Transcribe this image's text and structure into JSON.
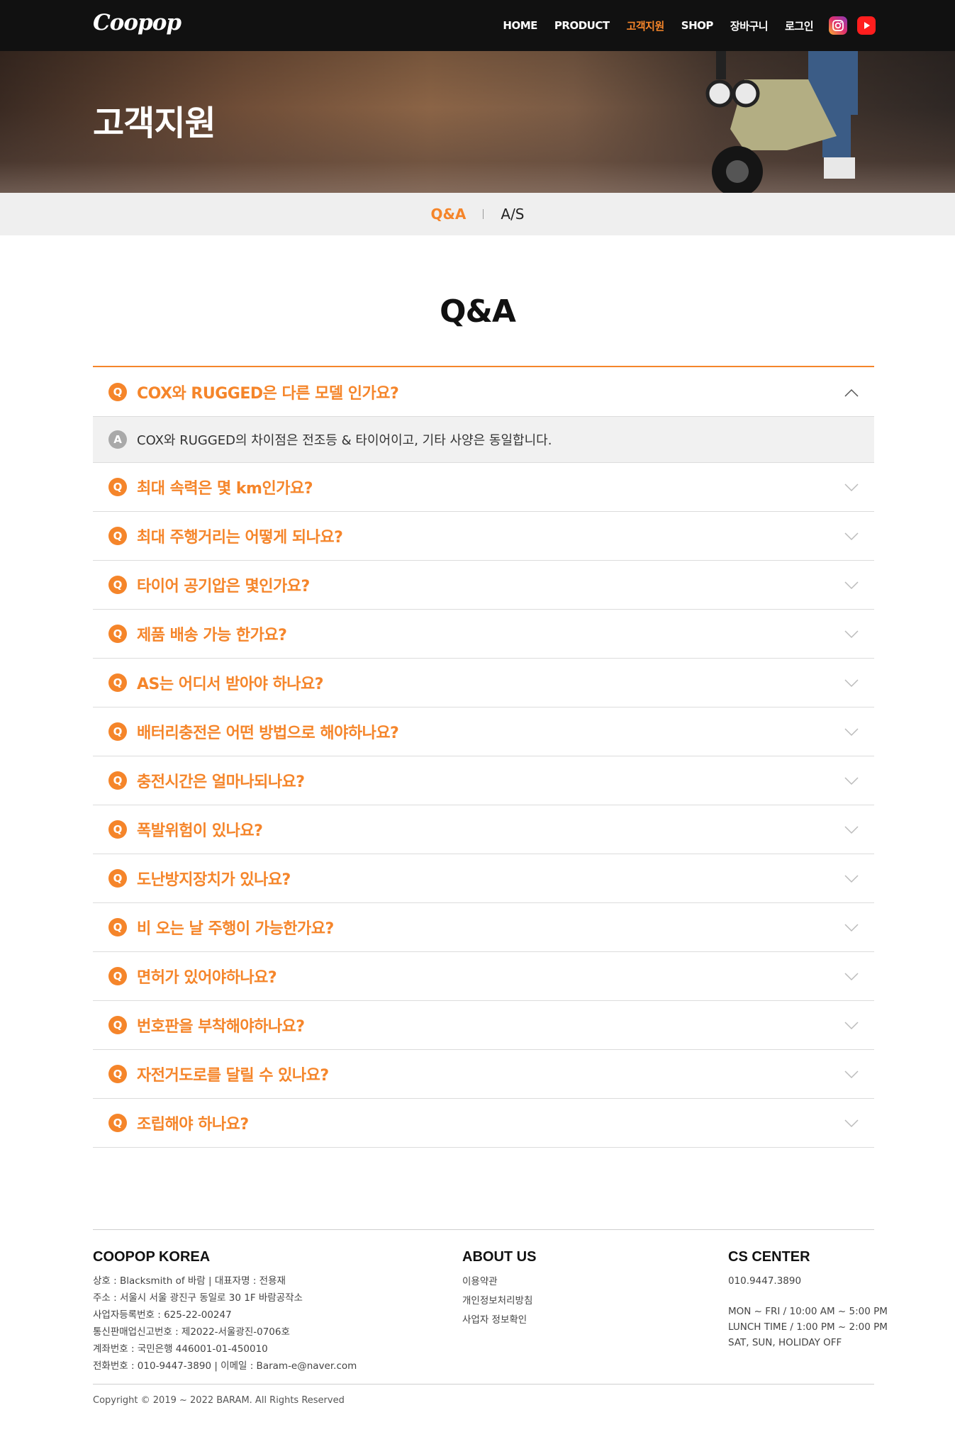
{
  "header": {
    "logo": "Coopop",
    "nav": [
      {
        "label": "HOME",
        "active": false
      },
      {
        "label": "PRODUCT",
        "active": false
      },
      {
        "label": "고객지원",
        "active": true
      },
      {
        "label": "SHOP",
        "active": false
      },
      {
        "label": "장바구니",
        "active": false
      },
      {
        "label": "로그인",
        "active": false
      }
    ],
    "sns": [
      {
        "icon": "instagram-icon",
        "color": "#e1306c"
      },
      {
        "icon": "youtube-icon",
        "color": "#ff1e1e"
      }
    ]
  },
  "hero": {
    "title": "고객지원"
  },
  "subnav": {
    "items": [
      {
        "label": "Q&A",
        "active": true
      },
      {
        "label": "A/S",
        "active": false
      }
    ]
  },
  "section": {
    "title": "Q&A"
  },
  "faq": {
    "badge_q": "Q",
    "badge_a": "A",
    "items": [
      {
        "question": "COX와 RUGGED은 다른 모델 인가요?",
        "answer": "COX와 RUGGED의 차이점은 전조등 & 타이어이고, 기타 사양은 동일합니다.",
        "open": true
      },
      {
        "question": "최대 속력은 몇 km인가요?",
        "open": false
      },
      {
        "question": "최대 주행거리는 어떻게 되나요?",
        "open": false
      },
      {
        "question": "타이어 공기압은 몇인가요?",
        "open": false
      },
      {
        "question": "제품 배송 가능 한가요?",
        "open": false
      },
      {
        "question": "AS는 어디서 받아야 하나요?",
        "open": false
      },
      {
        "question": "배터리충전은 어떤 방법으로 해야하나요?",
        "open": false
      },
      {
        "question": "충전시간은 얼마나되나요?",
        "open": false
      },
      {
        "question": "폭발위험이 있나요?",
        "open": false
      },
      {
        "question": "도난방지장치가 있나요?",
        "open": false
      },
      {
        "question": "비 오는 날 주행이 가능한가요?",
        "open": false
      },
      {
        "question": "면허가 있어야하나요?",
        "open": false
      },
      {
        "question": "번호판을 부착해야하나요?",
        "open": false
      },
      {
        "question": "자전거도로를 달릴 수 있나요?",
        "open": false
      },
      {
        "question": "조립해야 하나요?",
        "open": false
      }
    ]
  },
  "footer": {
    "company": {
      "title": "COOPOP KOREA",
      "lines": [
        "상호 : Blacksmith of 바람  |  대표자명 : 전용재",
        "주소 : 서울시 서울 광진구 동일로 30 1F 바람공작소",
        "사업자등록번호 : 625-22-00247",
        "통신판매업신고번호 : 제2022-서울광진-0706호",
        "계좌번호 : 국민은행 446001-01-450010",
        "전화번호 : 010-9447-3890  |  이메일 : Baram-e@naver.com"
      ]
    },
    "about": {
      "title": "ABOUT US",
      "links": [
        "이용약관",
        "개인정보처리방침",
        "사업자 정보확인"
      ]
    },
    "cs": {
      "title": "CS CENTER",
      "phone": "010.9447.3890",
      "hours": [
        "MON ~ FRI / 10:00 AM ~ 5:00 PM",
        "LUNCH TIME / 1:00 PM ~ 2:00 PM",
        "SAT, SUN, HOLIDAY OFF"
      ]
    },
    "copyright": "Copyright © 2019 ~ 2022 BARAM. All Rights Reserved"
  }
}
